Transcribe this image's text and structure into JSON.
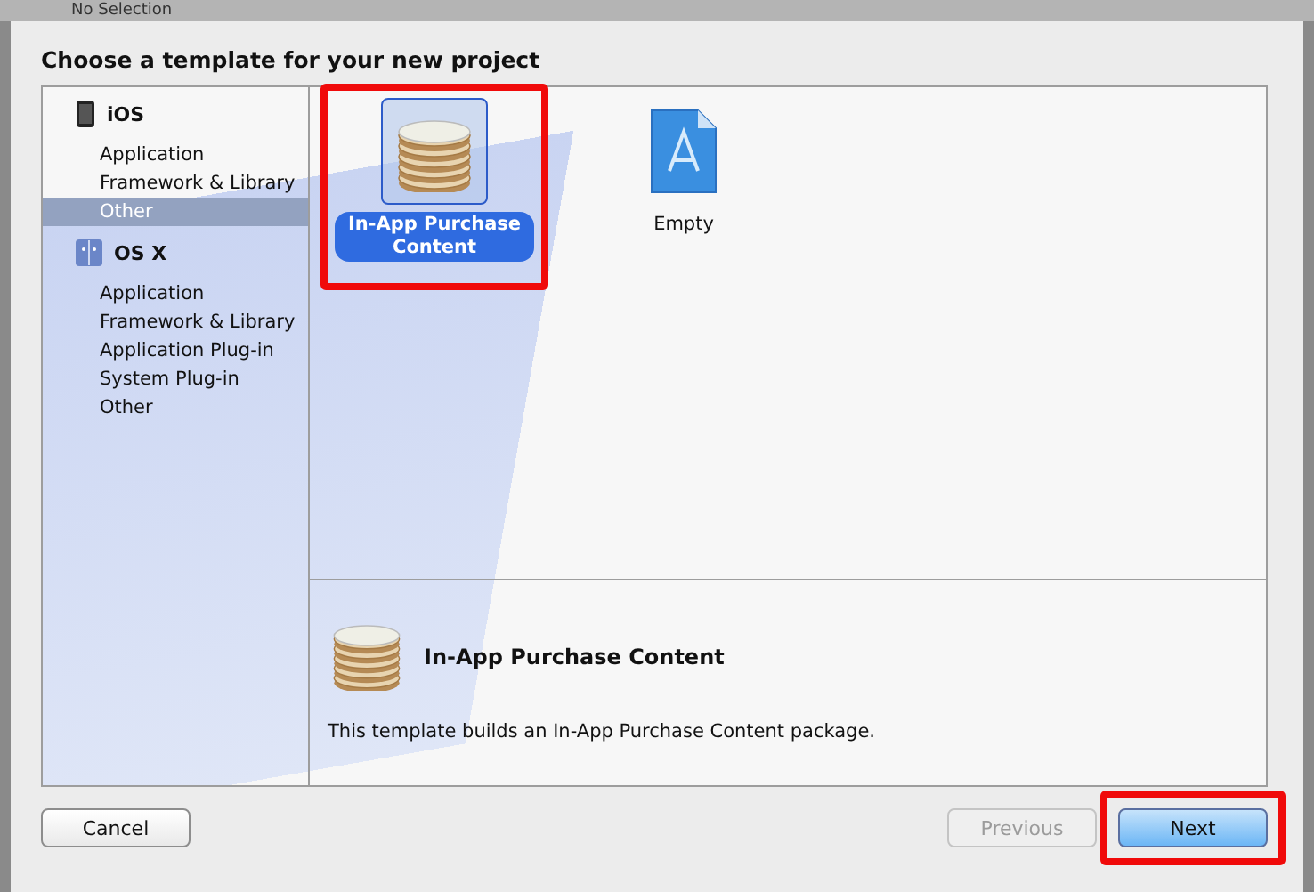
{
  "window": {
    "title": "No Selection"
  },
  "sheet": {
    "title": "Choose a template for your new project"
  },
  "sidebar": {
    "groups": [
      {
        "label": "iOS",
        "kind": "phone",
        "items": [
          {
            "label": "Application",
            "selected": false
          },
          {
            "label": "Framework & Library",
            "selected": false
          },
          {
            "label": "Other",
            "selected": true
          }
        ]
      },
      {
        "label": "OS X",
        "kind": "mac",
        "items": [
          {
            "label": "Application",
            "selected": false
          },
          {
            "label": "Framework & Library",
            "selected": false
          },
          {
            "label": "Application Plug-in",
            "selected": false
          },
          {
            "label": "System Plug-in",
            "selected": false
          },
          {
            "label": "Other",
            "selected": false
          }
        ]
      }
    ]
  },
  "templates": [
    {
      "label": "In-App Purchase Content",
      "kind": "coins",
      "selected": true,
      "highlighted": true
    },
    {
      "label": "Empty",
      "kind": "document",
      "selected": false,
      "highlighted": false
    }
  ],
  "description": {
    "title": "In-App Purchase Content",
    "kind": "coins",
    "text": "This template builds an In-App Purchase Content package."
  },
  "buttons": [
    {
      "label": "Cancel",
      "kind": "normal",
      "disabled": false,
      "highlighted": false
    },
    {
      "label": "Previous",
      "kind": "normal",
      "disabled": true,
      "highlighted": false
    },
    {
      "label": "Next",
      "kind": "default",
      "disabled": false,
      "highlighted": true
    }
  ]
}
